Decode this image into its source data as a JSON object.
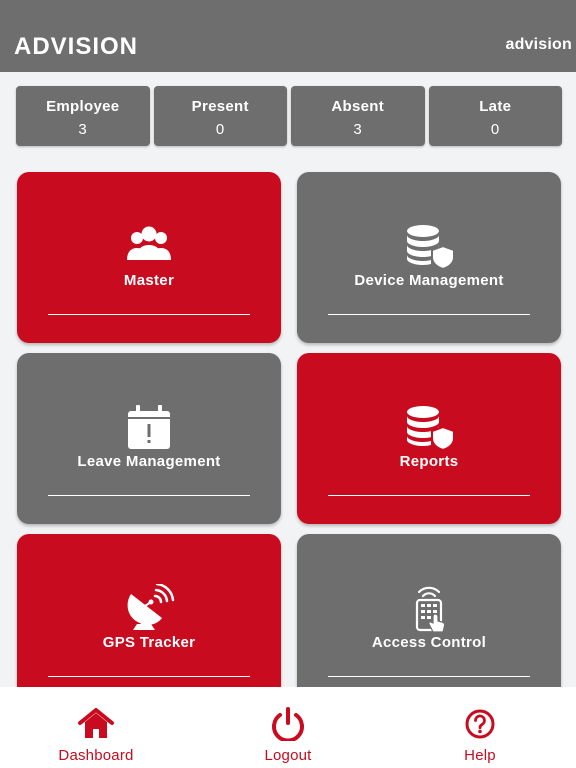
{
  "header": {
    "logo_text": "ADVISION",
    "user": "advision"
  },
  "stats": [
    {
      "label": "Employee",
      "value": "3"
    },
    {
      "label": "Present",
      "value": "0"
    },
    {
      "label": "Absent",
      "value": "3"
    },
    {
      "label": "Late",
      "value": "0"
    }
  ],
  "tiles": [
    {
      "label": "Master",
      "color": "#c90b1f",
      "icon": "users-group-icon"
    },
    {
      "label": "Device Management",
      "color": "#6e6e6e",
      "icon": "database-shield-icon"
    },
    {
      "label": "Leave Management",
      "color": "#6e6e6e",
      "icon": "calendar-alert-icon"
    },
    {
      "label": "Reports",
      "color": "#c90b1f",
      "icon": "database-shield-icon"
    },
    {
      "label": "GPS Tracker",
      "color": "#c90b1f",
      "icon": "satellite-dish-icon"
    },
    {
      "label": "Access Control",
      "color": "#6e6e6e",
      "icon": "keypad-touch-icon"
    }
  ],
  "bottom_nav": [
    {
      "label": "Dashboard",
      "icon": "home-icon"
    },
    {
      "label": "Logout",
      "icon": "power-icon"
    },
    {
      "label": "Help",
      "icon": "help-icon"
    }
  ],
  "colors": {
    "accent": "#c90b1f",
    "grey": "#6e6e6e",
    "background": "#f2f3f5"
  }
}
